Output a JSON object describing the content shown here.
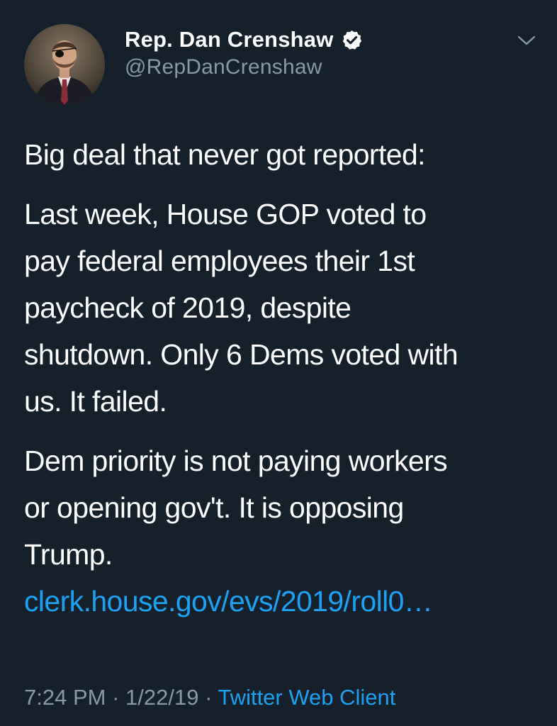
{
  "author": {
    "display_name": "Rep. Dan Crenshaw",
    "handle": "@RepDanCrenshaw"
  },
  "icons": {
    "verified": "verified-badge-icon",
    "menu": "chevron-down-icon"
  },
  "tweet": {
    "paragraph_1": "Big deal that never got reported:",
    "paragraph_2_lines": [
      "Last week, House GOP voted to",
      "pay federal employees their 1st",
      "paycheck of 2019, despite",
      "shutdown. Only 6 Dems voted with",
      "us. It failed."
    ],
    "paragraph_3_lines": [
      "Dem priority is not paying workers",
      "or opening gov't. It is opposing",
      "Trump."
    ],
    "link": "clerk.house.gov/evs/2019/roll0…"
  },
  "meta": {
    "time": "7:24 PM",
    "separator": " · ",
    "date": "1/22/19",
    "client": "Twitter Web Client"
  },
  "colors": {
    "background": "#15202b",
    "text": "#ffffff",
    "secondary": "#8899a6",
    "link": "#1da1f2"
  }
}
